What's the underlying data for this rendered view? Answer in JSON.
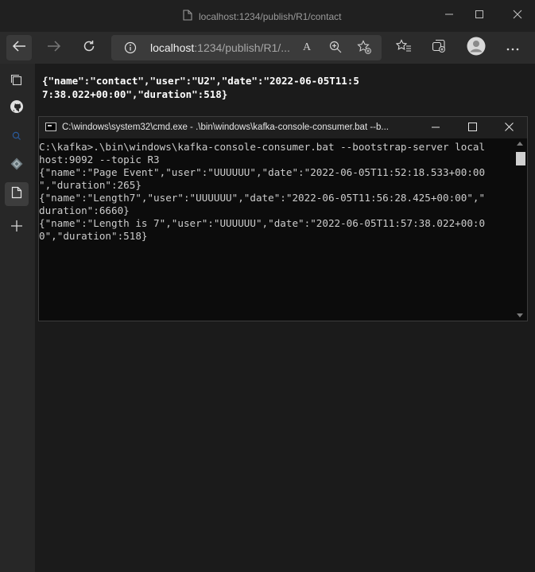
{
  "browser": {
    "title": "localhost:1234/publish/R1/contact",
    "address": {
      "host": "localhost",
      "path": ":1234/publish/R1/..."
    }
  },
  "page": {
    "json_text": "{\"name\":\"contact\",\"user\":\"U2\",\"date\":\"2022-06-05T11:57:38.022+00:00\",\"duration\":518}"
  },
  "console": {
    "title": "C:\\windows\\system32\\cmd.exe - .\\bin\\windows\\kafka-console-consumer.bat  --b...",
    "lines": [
      "C:\\kafka>.\\bin\\windows\\kafka-console-consumer.bat --bootstrap-server local",
      "host:9092 --topic R3",
      "{\"name\":\"Page Event\",\"user\":\"UUUUUU\",\"date\":\"2022-06-05T11:52:18.533+00:00",
      "\",\"duration\":265}",
      "{\"name\":\"Length7\",\"user\":\"UUUUUU\",\"date\":\"2022-06-05T11:56:28.425+00:00\",\"",
      "duration\":6660}",
      "{\"name\":\"Length is 7\",\"user\":\"UUUUUU\",\"date\":\"2022-06-05T11:57:38.022+00:0",
      "0\",\"duration\":518}"
    ]
  },
  "icons": {
    "page": "page-icon",
    "minimize": "minimize-icon",
    "maximize": "maximize-icon",
    "close": "close-icon",
    "back": "back-arrow-icon",
    "forward": "forward-arrow-icon",
    "refresh": "refresh-icon",
    "info": "info-icon",
    "read_aloud": "read-aloud-icon",
    "zoom": "zoom-icon",
    "add_favorite": "add-favorite-icon",
    "favorites": "favorites-icon",
    "collections": "collections-icon",
    "profile": "profile-icon",
    "more": "more-icon",
    "sidebar": [
      "tab-actions-icon",
      "github-icon",
      "search-icon",
      "image-icon",
      "document-icon",
      "add-icon"
    ]
  },
  "colors": {
    "titlebar": "#202020",
    "toolbar": "#2b2b2b",
    "sidebar": "#272727",
    "page_bg": "#1b1b1b",
    "console_bg": "#0c0c0c",
    "console_text": "#cccccc",
    "search_accent": "#2b5a9a"
  },
  "read_aloud_label": "A"
}
